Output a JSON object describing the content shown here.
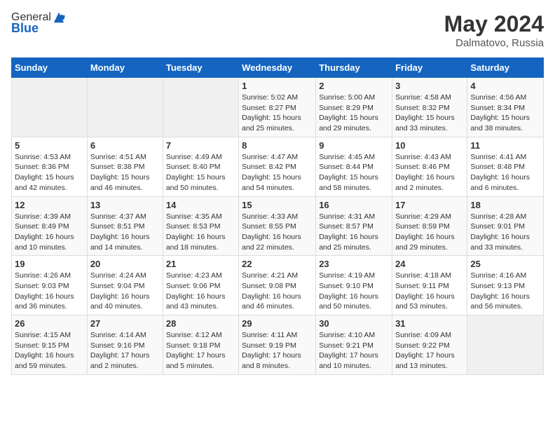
{
  "header": {
    "logo_general": "General",
    "logo_blue": "Blue",
    "month": "May 2024",
    "location": "Dalmatovo, Russia"
  },
  "days_of_week": [
    "Sunday",
    "Monday",
    "Tuesday",
    "Wednesday",
    "Thursday",
    "Friday",
    "Saturday"
  ],
  "weeks": [
    [
      {
        "day": "",
        "info": ""
      },
      {
        "day": "",
        "info": ""
      },
      {
        "day": "",
        "info": ""
      },
      {
        "day": "1",
        "info": "Sunrise: 5:02 AM\nSunset: 8:27 PM\nDaylight: 15 hours\nand 25 minutes."
      },
      {
        "day": "2",
        "info": "Sunrise: 5:00 AM\nSunset: 8:29 PM\nDaylight: 15 hours\nand 29 minutes."
      },
      {
        "day": "3",
        "info": "Sunrise: 4:58 AM\nSunset: 8:32 PM\nDaylight: 15 hours\nand 33 minutes."
      },
      {
        "day": "4",
        "info": "Sunrise: 4:56 AM\nSunset: 8:34 PM\nDaylight: 15 hours\nand 38 minutes."
      }
    ],
    [
      {
        "day": "5",
        "info": "Sunrise: 4:53 AM\nSunset: 8:36 PM\nDaylight: 15 hours\nand 42 minutes."
      },
      {
        "day": "6",
        "info": "Sunrise: 4:51 AM\nSunset: 8:38 PM\nDaylight: 15 hours\nand 46 minutes."
      },
      {
        "day": "7",
        "info": "Sunrise: 4:49 AM\nSunset: 8:40 PM\nDaylight: 15 hours\nand 50 minutes."
      },
      {
        "day": "8",
        "info": "Sunrise: 4:47 AM\nSunset: 8:42 PM\nDaylight: 15 hours\nand 54 minutes."
      },
      {
        "day": "9",
        "info": "Sunrise: 4:45 AM\nSunset: 8:44 PM\nDaylight: 15 hours\nand 58 minutes."
      },
      {
        "day": "10",
        "info": "Sunrise: 4:43 AM\nSunset: 8:46 PM\nDaylight: 16 hours\nand 2 minutes."
      },
      {
        "day": "11",
        "info": "Sunrise: 4:41 AM\nSunset: 8:48 PM\nDaylight: 16 hours\nand 6 minutes."
      }
    ],
    [
      {
        "day": "12",
        "info": "Sunrise: 4:39 AM\nSunset: 8:49 PM\nDaylight: 16 hours\nand 10 minutes."
      },
      {
        "day": "13",
        "info": "Sunrise: 4:37 AM\nSunset: 8:51 PM\nDaylight: 16 hours\nand 14 minutes."
      },
      {
        "day": "14",
        "info": "Sunrise: 4:35 AM\nSunset: 8:53 PM\nDaylight: 16 hours\nand 18 minutes."
      },
      {
        "day": "15",
        "info": "Sunrise: 4:33 AM\nSunset: 8:55 PM\nDaylight: 16 hours\nand 22 minutes."
      },
      {
        "day": "16",
        "info": "Sunrise: 4:31 AM\nSunset: 8:57 PM\nDaylight: 16 hours\nand 25 minutes."
      },
      {
        "day": "17",
        "info": "Sunrise: 4:29 AM\nSunset: 8:59 PM\nDaylight: 16 hours\nand 29 minutes."
      },
      {
        "day": "18",
        "info": "Sunrise: 4:28 AM\nSunset: 9:01 PM\nDaylight: 16 hours\nand 33 minutes."
      }
    ],
    [
      {
        "day": "19",
        "info": "Sunrise: 4:26 AM\nSunset: 9:03 PM\nDaylight: 16 hours\nand 36 minutes."
      },
      {
        "day": "20",
        "info": "Sunrise: 4:24 AM\nSunset: 9:04 PM\nDaylight: 16 hours\nand 40 minutes."
      },
      {
        "day": "21",
        "info": "Sunrise: 4:23 AM\nSunset: 9:06 PM\nDaylight: 16 hours\nand 43 minutes."
      },
      {
        "day": "22",
        "info": "Sunrise: 4:21 AM\nSunset: 9:08 PM\nDaylight: 16 hours\nand 46 minutes."
      },
      {
        "day": "23",
        "info": "Sunrise: 4:19 AM\nSunset: 9:10 PM\nDaylight: 16 hours\nand 50 minutes."
      },
      {
        "day": "24",
        "info": "Sunrise: 4:18 AM\nSunset: 9:11 PM\nDaylight: 16 hours\nand 53 minutes."
      },
      {
        "day": "25",
        "info": "Sunrise: 4:16 AM\nSunset: 9:13 PM\nDaylight: 16 hours\nand 56 minutes."
      }
    ],
    [
      {
        "day": "26",
        "info": "Sunrise: 4:15 AM\nSunset: 9:15 PM\nDaylight: 16 hours\nand 59 minutes."
      },
      {
        "day": "27",
        "info": "Sunrise: 4:14 AM\nSunset: 9:16 PM\nDaylight: 17 hours\nand 2 minutes."
      },
      {
        "day": "28",
        "info": "Sunrise: 4:12 AM\nSunset: 9:18 PM\nDaylight: 17 hours\nand 5 minutes."
      },
      {
        "day": "29",
        "info": "Sunrise: 4:11 AM\nSunset: 9:19 PM\nDaylight: 17 hours\nand 8 minutes."
      },
      {
        "day": "30",
        "info": "Sunrise: 4:10 AM\nSunset: 9:21 PM\nDaylight: 17 hours\nand 10 minutes."
      },
      {
        "day": "31",
        "info": "Sunrise: 4:09 AM\nSunset: 9:22 PM\nDaylight: 17 hours\nand 13 minutes."
      },
      {
        "day": "",
        "info": ""
      }
    ]
  ]
}
